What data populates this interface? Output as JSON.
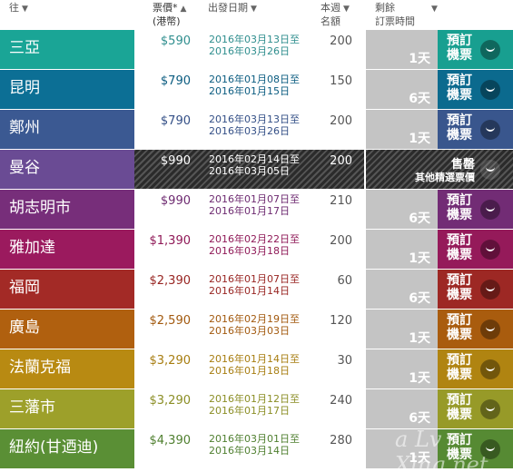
{
  "header": {
    "destination": "往",
    "price_line1": "票價*",
    "price_line2": "(港幣)",
    "date": "出發日期",
    "weekly_line1": "本週",
    "weekly_line2": "名額",
    "remain_line1": "剩餘",
    "remain_line2": "訂票時間",
    "sort_icon": "triangle-down-icon",
    "sort_icon_active": "triangle-up-icon"
  },
  "book_label": "預訂機票",
  "rows": [
    {
      "dest": "三亞",
      "price": "$590",
      "date1": "2016年03月13日至",
      "date2": "2016年03月26日",
      "quota": "200",
      "days": "1天",
      "color": "#1aa596",
      "bookColor": "#189f90",
      "textColor": "#2f8e8e"
    },
    {
      "dest": "昆明",
      "price": "$790",
      "date1": "2016年01月08日至",
      "date2": "2016年01月15日",
      "quota": "150",
      "days": "6天",
      "color": "#0c6f95",
      "bookColor": "#0b6a8e",
      "textColor": "#0b5c80"
    },
    {
      "dest": "鄭州",
      "price": "$790",
      "date1": "2016年03月13日至",
      "date2": "2016年03月26日",
      "quota": "200",
      "days": "1天",
      "color": "#3b5992",
      "bookColor": "#39568d",
      "textColor": "#334f86"
    },
    {
      "dest": "曼谷",
      "price": "$990",
      "date1": "2016年02月14日至",
      "date2": "2016年03月05日",
      "quota": "200",
      "days": "",
      "color": "#6a4b94",
      "soldOut": true,
      "sold1": "售罄",
      "sold2": "其他精選票價"
    },
    {
      "dest": "胡志明市",
      "price": "$990",
      "date1": "2016年01月07日至",
      "date2": "2016年01月17日",
      "quota": "210",
      "days": "6天",
      "color": "#772e7a",
      "bookColor": "#722c75",
      "textColor": "#6d2a70"
    },
    {
      "dest": "雅加達",
      "price": "$1,390",
      "date1": "2016年02月22日至",
      "date2": "2016年03月18日",
      "quota": "200",
      "days": "1天",
      "color": "#9b1a5e",
      "bookColor": "#951a5a",
      "textColor": "#8f1957"
    },
    {
      "dest": "福岡",
      "price": "$2,390",
      "date1": "2016年01月07日至",
      "date2": "2016年01月14日",
      "quota": "60",
      "days": "6天",
      "color": "#a32a26",
      "bookColor": "#9d2824",
      "textColor": "#982522"
    },
    {
      "dest": "廣島",
      "price": "$2,590",
      "date1": "2016年02月19日至",
      "date2": "2016年03月03日",
      "quota": "120",
      "days": "1天",
      "color": "#b0600f",
      "bookColor": "#a95c0e",
      "textColor": "#a2590e"
    },
    {
      "dest": "法蘭克福",
      "price": "$3,290",
      "date1": "2016年01月14日至",
      "date2": "2016年01月18日",
      "quota": "30",
      "days": "1天",
      "color": "#b88a12",
      "bookColor": "#b08411",
      "textColor": "#a77d10"
    },
    {
      "dest": "三藩市",
      "price": "$3,290",
      "date1": "2016年01月12日至",
      "date2": "2016年01月17日",
      "quota": "240",
      "days": "6天",
      "color": "#9da02a",
      "bookColor": "#979a28",
      "textColor": "#8b8e25"
    },
    {
      "dest": "紐約(甘迺迪)",
      "price": "$4,390",
      "date1": "2016年03月01日至",
      "date2": "2016年03月14日",
      "quota": "280",
      "days": "1天",
      "color": "#5a8f35",
      "bookColor": "#568a33",
      "textColor": "#4f7f2f"
    }
  ],
  "watermark": "a Lv Xing.net"
}
